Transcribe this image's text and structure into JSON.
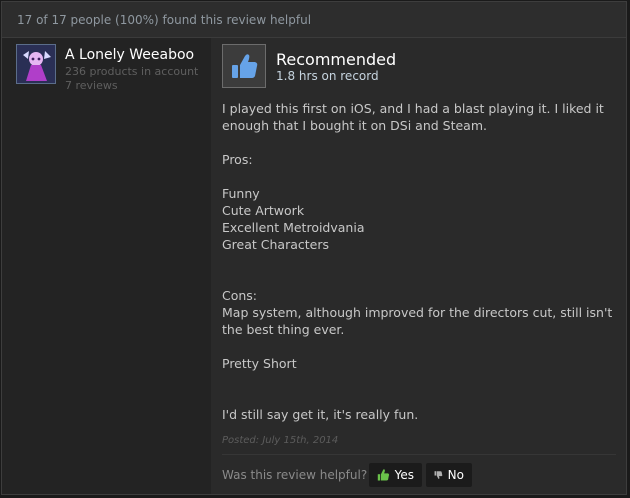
{
  "header": {
    "helpful_count": "17 of 17 people (100%) found this review helpful"
  },
  "author": {
    "name": "A Lonely Weeaboo",
    "products": "236 products in account",
    "reviews": "7 reviews"
  },
  "recommendation": {
    "label": "Recommended",
    "hours": "1.8 hrs on record",
    "icon": "thumbs-up-icon"
  },
  "review": {
    "paragraphs": [
      "I played this first on iOS, and I had a blast playing it. I liked it enough that I bought it on DSi and Steam.",
      "Pros:",
      "Funny\nCute Artwork\nExcellent Metroidvania\nGreat Characters",
      "",
      "Cons:\nMap system, although improved for the directors cut, still isn't the best thing ever.",
      "Pretty Short",
      "",
      "I'd still say get it, it's really fun."
    ],
    "posted": "Posted: July 15th, 2014"
  },
  "feedback": {
    "question": "Was this review helpful?",
    "yes_label": "Yes",
    "no_label": "No"
  },
  "colors": {
    "background": "#232323",
    "panel": "#2a2a2a",
    "yes_thumb": "#6ac14a",
    "no_thumb": "#b0b0b0",
    "recommend_icon": "#66a3e8"
  }
}
